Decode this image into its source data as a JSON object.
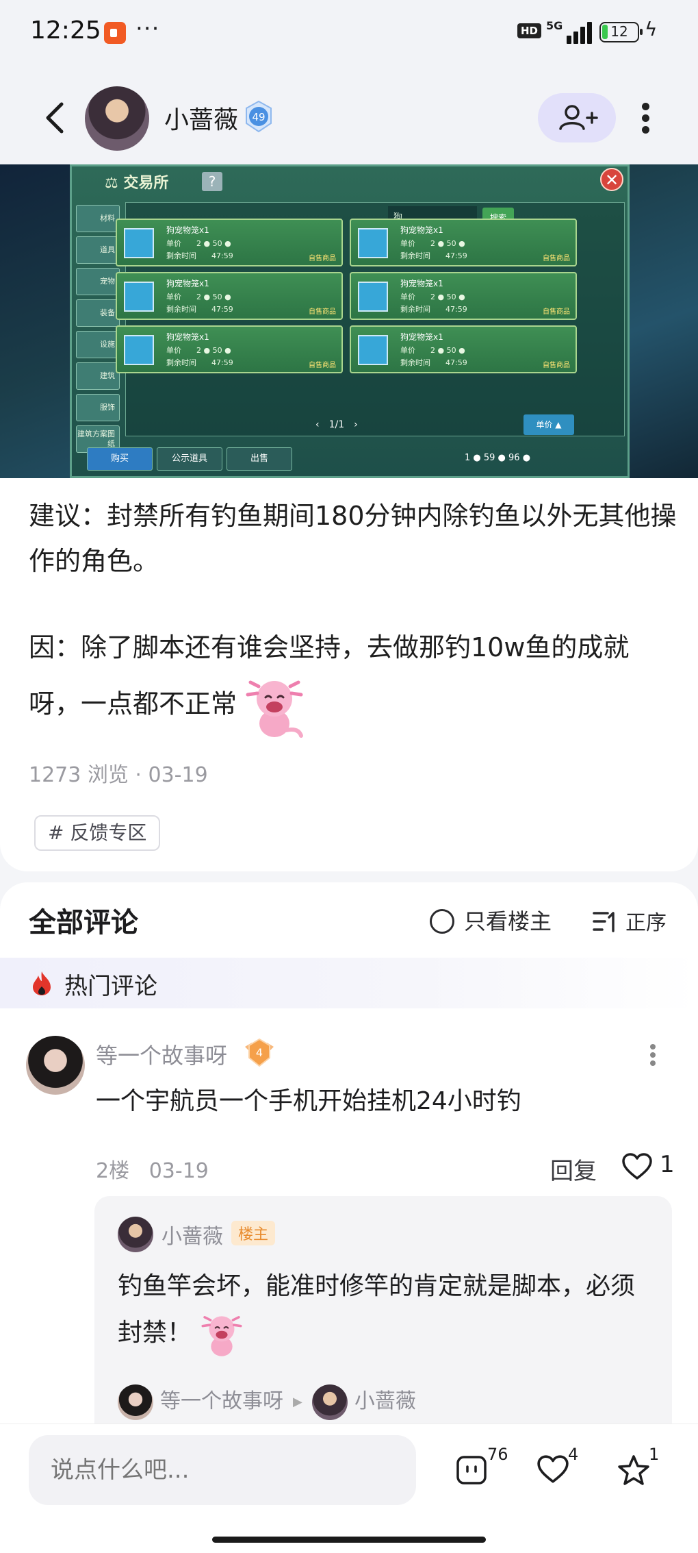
{
  "status_bar": {
    "time": "12:25",
    "dots": "···",
    "hd": "HD",
    "network": "5G",
    "battery": "12"
  },
  "header": {
    "author": "小蔷薇",
    "level": "49"
  },
  "screenshot": {
    "title": "交易所",
    "help": "?",
    "close": "✕",
    "sidebar": [
      "材料",
      "道具",
      "宠物",
      "装备",
      "设施",
      "建筑",
      "服饰",
      "建筑方案图纸"
    ],
    "search_value": "狗",
    "search_button": "搜索",
    "item_name": "狗宠物笼x1",
    "price_line": "单价　　2 ● 50 ●",
    "time_line": "剩余时间　　47:59",
    "item_tag": "自售商品",
    "pager": "‹　1/1　›",
    "sort_button": "单价 ▲",
    "tabs": [
      "购买",
      "公示道具",
      "出售"
    ],
    "money": "1 ● 59 ● 96 ●"
  },
  "post": {
    "paragraph1": "建议：封禁所有钓鱼期间180分钟内除钓鱼以外无其他操作的角色。",
    "paragraph2": "因：除了脚本还有谁会坚持，去做那钓10w鱼的成就呀，一点都不正常",
    "views": "1273 浏览",
    "date": "03-19",
    "topic": "# 反馈专区"
  },
  "comments": {
    "title": "全部评论",
    "only_author": "只看楼主",
    "sort": "正序",
    "hot_label": "热门评论",
    "items": [
      {
        "user": "等一个故事呀",
        "level": "4",
        "text": "一个宇航员一个手机开始挂机24小时钓",
        "floor": "2楼",
        "date": "03-19",
        "reply_label": "回复",
        "likes": "1",
        "replies": [
          {
            "user": "小蔷薇",
            "tag": "楼主",
            "text": "钓鱼竿会坏，能准时修竿的肯定就是脚本，必须封禁！"
          }
        ],
        "reply_chain": {
          "from": "等一个故事呀",
          "to": "小蔷薇"
        }
      }
    ]
  },
  "bottom_bar": {
    "input_placeholder": "说点什么吧...",
    "comments_count": "76",
    "likes_count": "4",
    "favorites_count": "1"
  },
  "colors": {
    "follow_bg": "#e2e0fa",
    "author_tag": "#e88a2c",
    "level_badge": "#4a90e2",
    "user_badge": "#f5a04a"
  }
}
